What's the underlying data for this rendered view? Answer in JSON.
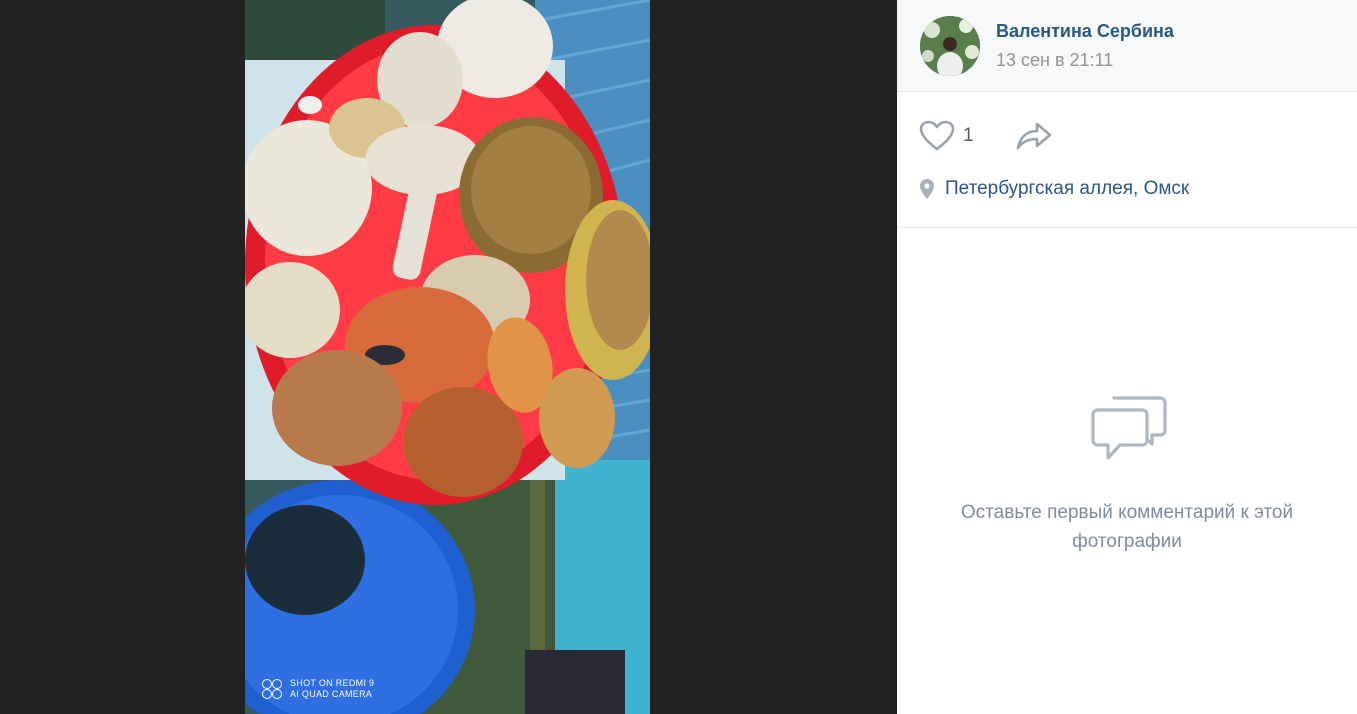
{
  "photo": {
    "watermark": {
      "line1": "SHOT ON REDMI 9",
      "line2": "AI QUAD CAMERA"
    }
  },
  "post": {
    "author": "Валентина Сербина",
    "date": "13 сен в 21:11",
    "likes": "1",
    "location": "Петербургская аллея, Омск"
  },
  "comments": {
    "empty_text": "Оставьте первый комментарий к этой фотографии"
  },
  "colors": {
    "link": "#2a5885",
    "muted": "#939393",
    "icon": "#99a2ad"
  },
  "icons": [
    "like-icon",
    "share-icon",
    "location-pin-icon",
    "comments-icon"
  ]
}
